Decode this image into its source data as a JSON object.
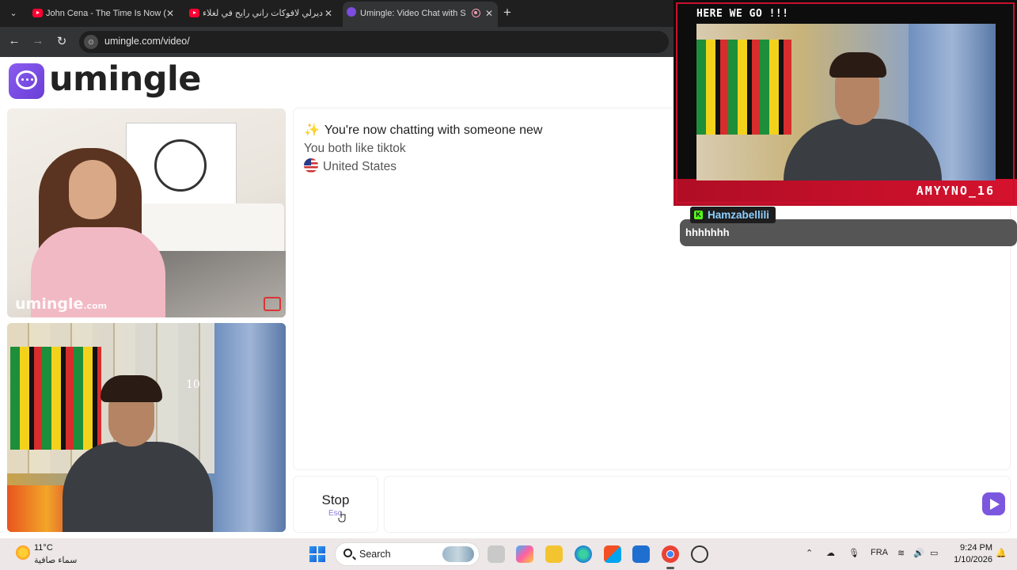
{
  "browser": {
    "tabs": [
      {
        "label": "John Cena - The Time Is Now (",
        "active": false
      },
      {
        "label": "ديرلي لافوكات راني رايح في لغلاء",
        "active": false
      },
      {
        "label": "Umingle: Video Chat with S",
        "active": true
      }
    ],
    "url": "umingle.com/video/"
  },
  "site": {
    "logo_text": "umingle",
    "watermark_main": "umingle",
    "watermark_tld": ".com"
  },
  "chat": {
    "system_message": "You're now chatting with someone new",
    "interest": "You both like tiktok",
    "country": "United States",
    "stop_label": "Stop",
    "stop_hint": "Esc"
  },
  "overlay": {
    "title": "HERE WE GO !!!",
    "streamer_name": "AMYYNO_16",
    "jersey_number": "10",
    "chat_user": "Hamzabellili",
    "chat_message": "hhhhhhh"
  },
  "taskbar": {
    "temperature": "11°C",
    "weather_desc": "سماء صافية",
    "search_label": "Search",
    "language": "FRA",
    "time": "9:24 PM",
    "date": "1/10/2026"
  },
  "colors": {
    "brand": "#7b57e0",
    "overlay_accent": "#c8102e",
    "kick_green": "#53fc18"
  }
}
